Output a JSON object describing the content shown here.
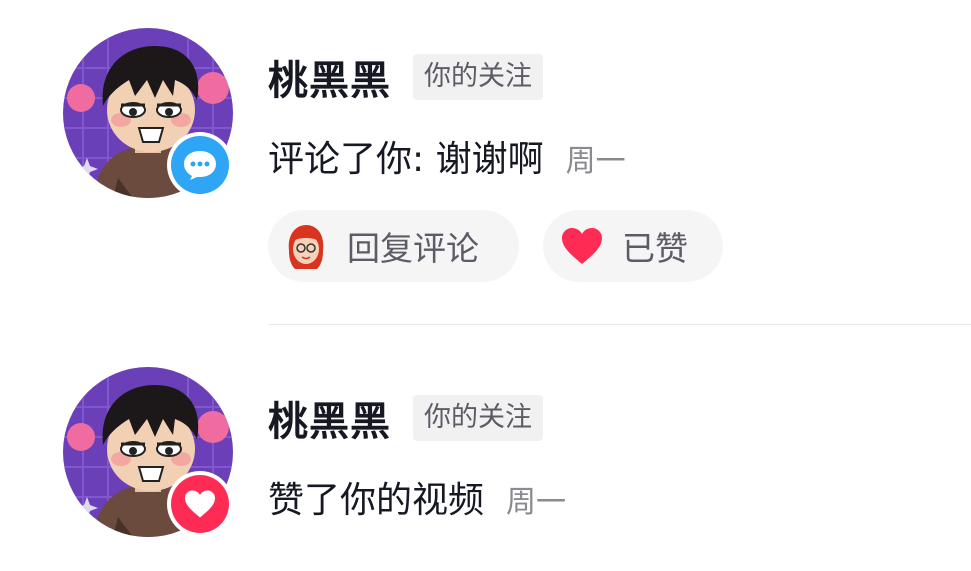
{
  "colors": {
    "comment_badge": "#2ea5f5",
    "like_badge": "#fe2c55",
    "username": "#161823",
    "secondary_text": "#8a8b91",
    "tag_bg": "#f1f1f2",
    "pill_bg": "#f5f5f6"
  },
  "notifications": [
    {
      "username": "桃黑黑",
      "follow_tag": "你的关注",
      "action": "评论了你: 谢谢啊",
      "time": "周一",
      "badge_icon": "comment-bubble-icon",
      "reply_label": "回复评论",
      "like_label": "已赞"
    },
    {
      "username": "桃黑黑",
      "follow_tag": "你的关注",
      "action": "赞了你的视频",
      "time": "周一",
      "badge_icon": "heart-icon"
    }
  ]
}
